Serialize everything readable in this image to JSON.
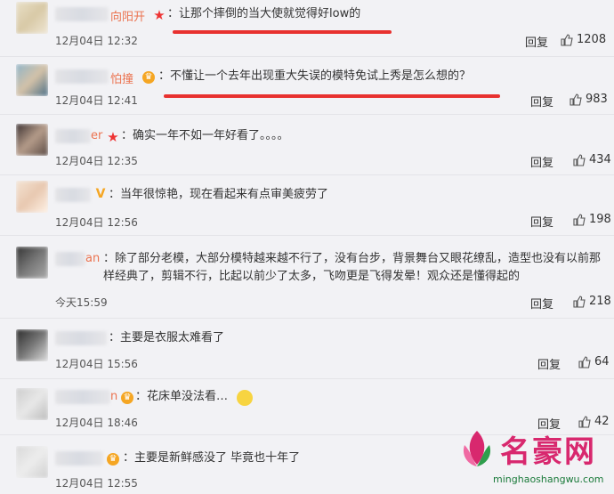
{
  "comments": [
    {
      "name": "向阳开",
      "badge": "★",
      "text": "：让那个摔倒的当大使就觉得好low的",
      "time": "12月04日 12:32",
      "reply": "回复",
      "likes": "1208"
    },
    {
      "name": "怕撞",
      "badge": "",
      "text": "：不懂让一个去年出现重大失误的模特免试上秀是怎么想的？",
      "time": "12月04日 12:41",
      "reply": "回复",
      "likes": "983"
    },
    {
      "name": "er",
      "badge": "★",
      "text": "：确实一年不如一年好看了。。。。",
      "time": "12月04日 12:35",
      "reply": "回复",
      "likes": "434"
    },
    {
      "name": "",
      "badge": "V",
      "text": "：当年很惊艳，现在看起来有点审美疲劳了",
      "time": "12月04日 12:56",
      "reply": "回复",
      "likes": "198"
    },
    {
      "name": "an",
      "badge": "",
      "text": "：除了部分老模，大部分模特越来越不行了，没有台步，背景舞台又眼花缭乱，造型也没有以前那样经典了，剪辑不行，比起以前少了太多，飞吻更是飞得发晕！观众还是懂得起的",
      "time": "今天15:59",
      "reply": "回复",
      "likes": "218"
    },
    {
      "name": "",
      "badge": "",
      "text": "：主要是衣服太难看了",
      "time": "12月04日 15:56",
      "reply": "回复",
      "likes": "64"
    },
    {
      "name": "n",
      "badge": "",
      "text": "：花床单没法看…",
      "time": "12月04日 18:46",
      "reply": "回复",
      "likes": "42"
    },
    {
      "name": "",
      "badge": "",
      "text": "：主要是新鲜感没了 毕竟也十年了",
      "time": "12月04日 12:55",
      "reply": "",
      "likes": ""
    }
  ],
  "watermark": {
    "title": "名豪网",
    "url": "minghaoshangwu.com"
  },
  "colors": {
    "highlight": "#e8312f",
    "name": "#eb7350",
    "background": "#f2f2f5"
  }
}
